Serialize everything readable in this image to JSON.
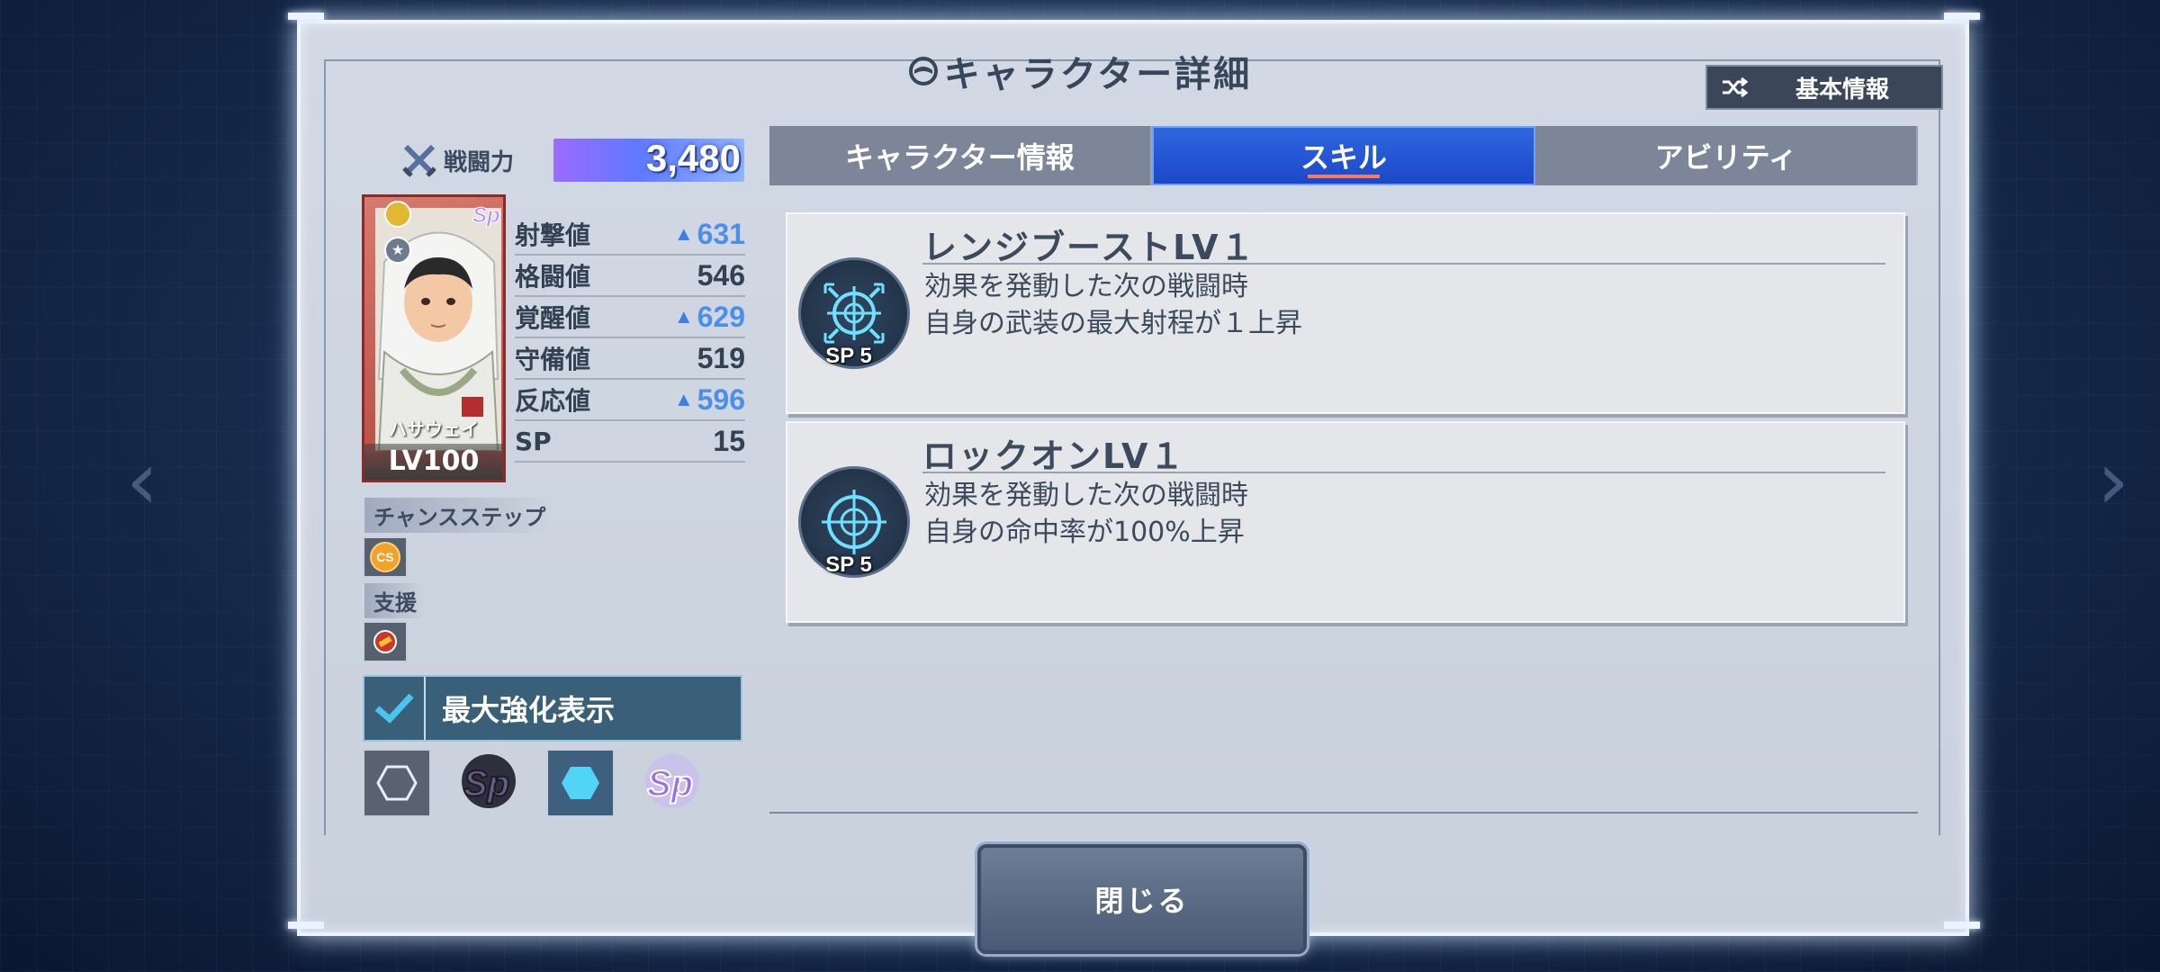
{
  "header": {
    "title": "キャラクター詳細",
    "basic_info_button": "基本情報"
  },
  "power": {
    "label": "戦闘力",
    "value": "3,480"
  },
  "character": {
    "name": "ハサウェイ",
    "level": "LV100"
  },
  "stats": [
    {
      "label": "射撃値",
      "value": "631",
      "boosted": true
    },
    {
      "label": "格闘値",
      "value": "546",
      "boosted": false
    },
    {
      "label": "覚醒値",
      "value": "629",
      "boosted": true
    },
    {
      "label": "守備値",
      "value": "519",
      "boosted": false
    },
    {
      "label": "反応値",
      "value": "596",
      "boosted": true
    },
    {
      "label": "SP",
      "value": "15",
      "boosted": false
    }
  ],
  "chance_step": {
    "label": "チャンスステップ",
    "badge": "CS"
  },
  "support": {
    "label": "支援"
  },
  "max_toggle": {
    "label": "最大強化表示",
    "checked": true
  },
  "tabs": [
    {
      "label": "キャラクター情報",
      "active": false
    },
    {
      "label": "スキル",
      "active": true
    },
    {
      "label": "アビリティ",
      "active": false
    }
  ],
  "skills": [
    {
      "name": "レンジブーストLV１",
      "sp": "SP 5",
      "desc1": "効果を発動した次の戦闘時",
      "desc2": "自身の武装の最大射程が１上昇",
      "icon": "range-boost-icon"
    },
    {
      "name": "ロックオンLV１",
      "sp": "SP 5",
      "desc1": "効果を発動した次の戦闘時",
      "desc2": "自身の命中率が100%上昇",
      "icon": "lock-on-icon"
    }
  ],
  "close_button": "閉じる",
  "colors": {
    "active_tab": "#1c48c7",
    "boost_value": "#4d8fe6",
    "frame": "#c9d1dd"
  }
}
